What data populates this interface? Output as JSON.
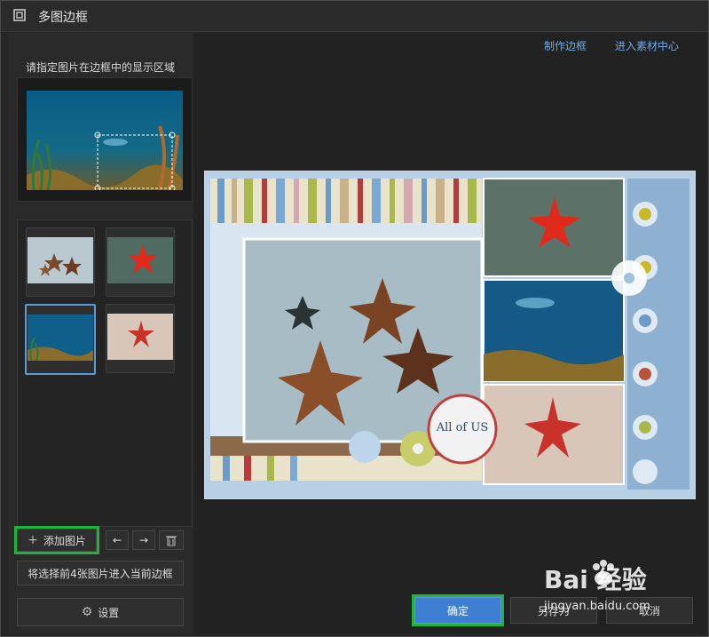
{
  "window": {
    "title": "多图边框"
  },
  "left_panel": {
    "hint": "请指定图片在边框中的显示区域",
    "add_image_label": "添加图片",
    "apply_first_label": "将选择前4张图片进入当前边框",
    "settings_label": "设置"
  },
  "toolbar_links": {
    "make_border": "制作边框",
    "enter_material_center": "进入素材中心"
  },
  "thumbnails": [
    {
      "name": "starfish-sand",
      "selected": false
    },
    {
      "name": "red-starfish-reef",
      "selected": false
    },
    {
      "name": "underwater-scene",
      "selected": true
    },
    {
      "name": "red-starfish-beach",
      "selected": false
    }
  ],
  "preview": {
    "collage_text": "All of US"
  },
  "footer": {
    "ok_label": "确定",
    "save_as_label": "另存为",
    "cancel_label": "取消"
  },
  "watermark": {
    "brand": "Bai 经验",
    "site": "jingyan.baidu.com"
  },
  "colors": {
    "accent": "#5b9bd5",
    "highlight": "#1fb43a",
    "primary": "#3f7fd1",
    "link": "#6fa8e6"
  }
}
